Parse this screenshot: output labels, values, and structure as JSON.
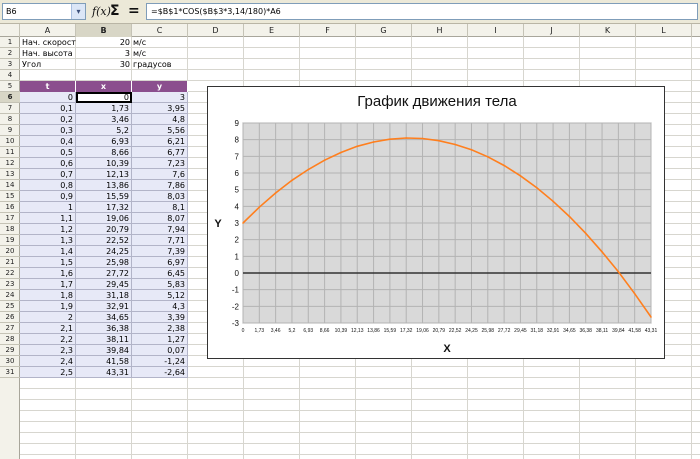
{
  "toolbar": {
    "name_box": "B6",
    "fx_icon": "function-wizard-icon",
    "sum_icon": "sum-icon",
    "equals_icon": "equals-icon",
    "formula": "=$B$1*COS($B$3*3,14/180)*A6"
  },
  "columns": [
    "A",
    "B",
    "C",
    "D",
    "E",
    "F",
    "G",
    "H",
    "I",
    "J",
    "K",
    "L"
  ],
  "rows": [
    "1",
    "2",
    "3",
    "4",
    "5",
    "6",
    "7",
    "8",
    "9",
    "10",
    "11",
    "12",
    "13",
    "14",
    "15",
    "16",
    "17",
    "18",
    "19",
    "20",
    "21",
    "22",
    "23",
    "24",
    "25",
    "26",
    "27",
    "28",
    "29",
    "30",
    "31"
  ],
  "active": {
    "column": "B",
    "row": "6"
  },
  "params": [
    {
      "label": "Нач. скорость",
      "value": "20",
      "unit": "м/с"
    },
    {
      "label": "Нач. высота",
      "value": "3",
      "unit": "м/с"
    },
    {
      "label": "Угол",
      "value": "30",
      "unit": "градусов"
    }
  ],
  "table": {
    "headers": [
      "t",
      "x",
      "y"
    ],
    "rows": [
      [
        "0",
        "0",
        "3"
      ],
      [
        "0,1",
        "1,73",
        "3,95"
      ],
      [
        "0,2",
        "3,46",
        "4,8"
      ],
      [
        "0,3",
        "5,2",
        "5,56"
      ],
      [
        "0,4",
        "6,93",
        "6,21"
      ],
      [
        "0,5",
        "8,66",
        "6,77"
      ],
      [
        "0,6",
        "10,39",
        "7,23"
      ],
      [
        "0,7",
        "12,13",
        "7,6"
      ],
      [
        "0,8",
        "13,86",
        "7,86"
      ],
      [
        "0,9",
        "15,59",
        "8,03"
      ],
      [
        "1",
        "17,32",
        "8,1"
      ],
      [
        "1,1",
        "19,06",
        "8,07"
      ],
      [
        "1,2",
        "20,79",
        "7,94"
      ],
      [
        "1,3",
        "22,52",
        "7,71"
      ],
      [
        "1,4",
        "24,25",
        "7,39"
      ],
      [
        "1,5",
        "25,98",
        "6,97"
      ],
      [
        "1,6",
        "27,72",
        "6,45"
      ],
      [
        "1,7",
        "29,45",
        "5,83"
      ],
      [
        "1,8",
        "31,18",
        "5,12"
      ],
      [
        "1,9",
        "32,91",
        "4,3"
      ],
      [
        "2",
        "34,65",
        "3,39"
      ],
      [
        "2,1",
        "36,38",
        "2,38"
      ],
      [
        "2,2",
        "38,11",
        "1,27"
      ],
      [
        "2,3",
        "39,84",
        "0,07"
      ],
      [
        "2,4",
        "41,58",
        "-1,24"
      ],
      [
        "2,5",
        "43,31",
        "-2,64"
      ]
    ]
  },
  "chart_data": {
    "type": "line",
    "title": "График движения тела",
    "xlabel": "X",
    "ylabel": "Y",
    "ylim": [
      -3,
      9
    ],
    "yticks": [
      "9",
      "8",
      "7",
      "6",
      "5",
      "4",
      "3",
      "2",
      "1",
      "0",
      "-1",
      "-2",
      "-3"
    ],
    "grid": true,
    "legend": "none",
    "line_color": "#ff7f1e",
    "zero_line_color": "#333333",
    "plot_bg": "#d9d9d9",
    "x": [
      "0",
      "1,73",
      "3,46",
      "5,2",
      "6,93",
      "8,66",
      "10,39",
      "12,13",
      "13,86",
      "15,59",
      "17,32",
      "19,06",
      "20,79",
      "22,52",
      "24,25",
      "25,98",
      "27,72",
      "29,45",
      "31,18",
      "32,91",
      "34,65",
      "36,38",
      "38,11",
      "39,84",
      "41,58",
      "43,31"
    ],
    "series": [
      {
        "values": [
          3,
          3.95,
          4.8,
          5.56,
          6.21,
          6.77,
          7.23,
          7.6,
          7.86,
          8.03,
          8.1,
          8.07,
          7.94,
          7.71,
          7.39,
          6.97,
          6.45,
          5.83,
          5.12,
          4.3,
          3.39,
          2.38,
          1.27,
          0.07,
          -1.24,
          -2.64
        ]
      }
    ]
  }
}
